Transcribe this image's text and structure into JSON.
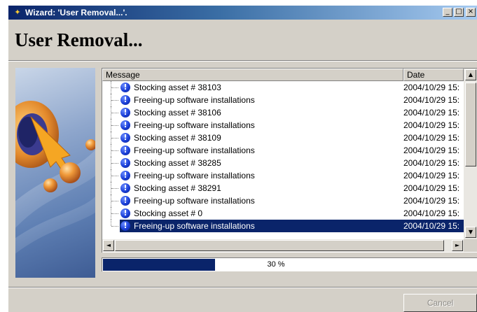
{
  "window": {
    "title": "Wizard: 'User Removal...'.",
    "controls": {
      "minimize": "_",
      "maximize": "□",
      "close": "×"
    }
  },
  "header": {
    "title": "User Removal..."
  },
  "list": {
    "columns": [
      {
        "label": "Message"
      },
      {
        "label": "Date"
      }
    ],
    "rows": [
      {
        "message": "Stocking asset # 38103",
        "date": "2004/10/29 15:",
        "icon": "info-icon",
        "selected": false
      },
      {
        "message": "Freeing-up software installations",
        "date": "2004/10/29 15:",
        "icon": "info-icon",
        "selected": false
      },
      {
        "message": "Stocking asset # 38106",
        "date": "2004/10/29 15:",
        "icon": "info-icon",
        "selected": false
      },
      {
        "message": "Freeing-up software installations",
        "date": "2004/10/29 15:",
        "icon": "info-icon",
        "selected": false
      },
      {
        "message": "Stocking asset # 38109",
        "date": "2004/10/29 15:",
        "icon": "info-icon",
        "selected": false
      },
      {
        "message": "Freeing-up software installations",
        "date": "2004/10/29 15:",
        "icon": "info-icon",
        "selected": false
      },
      {
        "message": "Stocking asset # 38285",
        "date": "2004/10/29 15:",
        "icon": "info-icon",
        "selected": false
      },
      {
        "message": "Freeing-up software installations",
        "date": "2004/10/29 15:",
        "icon": "info-icon",
        "selected": false
      },
      {
        "message": "Stocking asset # 38291",
        "date": "2004/10/29 15:",
        "icon": "info-icon",
        "selected": false
      },
      {
        "message": "Freeing-up software installations",
        "date": "2004/10/29 15:",
        "icon": "info-icon",
        "selected": false
      },
      {
        "message": "Stocking asset # 0",
        "date": "2004/10/29 15:",
        "icon": "info-icon",
        "selected": false
      },
      {
        "message": "Freeing-up software installations",
        "date": "2004/10/29 15:",
        "icon": "info-icon",
        "selected": true
      }
    ],
    "scroll": {
      "up": "▲",
      "down": "▼",
      "left": "◄",
      "right": "►"
    }
  },
  "progress": {
    "value": 0.3,
    "label": "30 %"
  },
  "footer": {
    "cancel_label": "Cancel",
    "cancel_enabled": false
  },
  "colors": {
    "titlebar_start": "#0a246a",
    "titlebar_end": "#a6caf0",
    "selection": "#0a246a",
    "progress_fill": "#0a246a",
    "face": "#d4d0c8"
  }
}
